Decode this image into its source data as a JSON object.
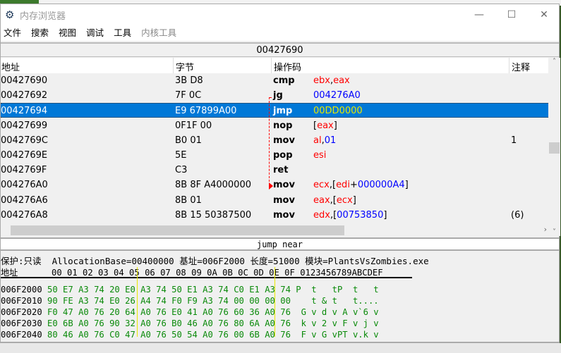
{
  "window": {
    "title": "内存浏览器",
    "icon": "cheat-engine-gear-icon",
    "controls": [
      "minimize",
      "maximize",
      "close"
    ]
  },
  "menu": [
    "文件",
    "搜索",
    "视图",
    "调试",
    "工具",
    "内核工具"
  ],
  "address_bar": "00427690",
  "columns": [
    "地址",
    "字节",
    "操作码",
    "注释"
  ],
  "rows": [
    {
      "addr": "00427690",
      "bytes": "3B D8",
      "op": "cmp",
      "operand": [
        [
          "ebx",
          "r"
        ],
        [
          ",",
          "k"
        ],
        [
          "eax",
          "r"
        ]
      ],
      "comment": ""
    },
    {
      "addr": "00427692",
      "bytes": "7F 0C",
      "op": "jg",
      "operand": [
        [
          "004276A0",
          "b"
        ]
      ],
      "comment": ""
    },
    {
      "addr": "00427694",
      "bytes": "E9 67899A00",
      "op": "jmp",
      "operand": [
        [
          "00DD0000",
          "y"
        ]
      ],
      "comment": "",
      "selected": true
    },
    {
      "addr": "00427699",
      "bytes": "0F1F 00",
      "op": "nop",
      "operand": [
        [
          "[",
          "k"
        ],
        [
          "eax",
          "r"
        ],
        [
          "]",
          "k"
        ]
      ],
      "comment": ""
    },
    {
      "addr": "0042769C",
      "bytes": "B0 01",
      "op": "mov",
      "operand": [
        [
          "al",
          "r"
        ],
        [
          ",",
          "k"
        ],
        [
          "01",
          "b"
        ]
      ],
      "comment": "1"
    },
    {
      "addr": "0042769E",
      "bytes": "5E",
      "op": "pop",
      "operand": [
        [
          "esi",
          "r"
        ]
      ],
      "comment": ""
    },
    {
      "addr": "0042769F",
      "bytes": "C3",
      "op": "ret",
      "operand": [],
      "comment": ""
    },
    {
      "addr": "004276A0",
      "bytes": "8B 8F A4000000",
      "op": "mov",
      "operand": [
        [
          "ecx",
          "r"
        ],
        [
          ",[",
          "k"
        ],
        [
          "edi",
          "r"
        ],
        [
          "+",
          "k"
        ],
        [
          "000000A4",
          "b"
        ],
        [
          "]",
          "k"
        ]
      ],
      "comment": ""
    },
    {
      "addr": "004276A6",
      "bytes": "8B 01",
      "op": "mov",
      "operand": [
        [
          "eax",
          "r"
        ],
        [
          ",[",
          "k"
        ],
        [
          "ecx",
          "r"
        ],
        [
          "]",
          "k"
        ]
      ],
      "comment": ""
    },
    {
      "addr": "004276A8",
      "bytes": "8B 15 50387500",
      "op": "mov",
      "operand": [
        [
          "edx",
          "r"
        ],
        [
          ",[",
          "k"
        ],
        [
          "00753850",
          "b"
        ],
        [
          "]",
          "k"
        ]
      ],
      "comment": "(6)"
    }
  ],
  "status": "jump near",
  "hex": {
    "info": "保护:只读  AllocationBase=00400000 基址=006F2000 长度=51000 模块=PlantsVsZombies.exe",
    "header_addr": "地址",
    "header_cols": "00 01 02 03 04 05 06 07 08 09 0A 0B 0C 0D 0E 0F 0123456789ABCDEF",
    "rows": [
      {
        "addr": "006F2000",
        "data": "50 E7 A3 74 20 E0 A3 74 50 E1 A3 74 C0 E1 A3 74 P  t   tP  t   t"
      },
      {
        "addr": "006F2010",
        "data": "90 FE A3 74 E0 26 A4 74 F0 F9 A3 74 00 00 00 00    t & t   t...."
      },
      {
        "addr": "006F2020",
        "data": "F0 47 A0 76 20 64 A0 76 E0 41 A0 76 60 36 A0 76  G v d v A v`6 v"
      },
      {
        "addr": "006F2030",
        "data": "E0 6B A0 76 90 32 A0 76 B0 46 A0 76 80 6A A0 76  k v 2 v F v j v"
      },
      {
        "addr": "006F2040",
        "data": "80 46 A0 76 C0 47 A0 76 50 54 A0 76 00 6B A0 76  F v G vPT v.k v"
      }
    ]
  },
  "colors": {
    "selection": "#0078d7",
    "register": "#ff0000",
    "number": "#0000ff",
    "hex_data": "#0a8a0a",
    "jump_target": "#e8e800"
  }
}
